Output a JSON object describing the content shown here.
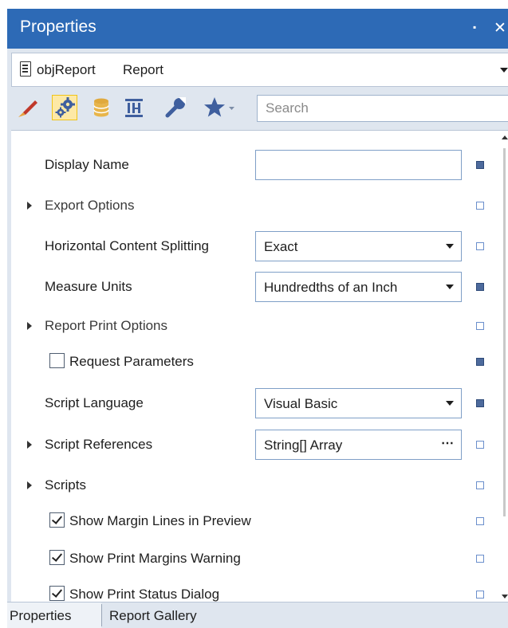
{
  "panel": {
    "title": "Properties",
    "pin_glyph": "▪",
    "close_glyph": "✕"
  },
  "object_selector": {
    "name": "objReport",
    "type": "Report"
  },
  "toolbar": {
    "icons": [
      "brush-icon",
      "gears-icon",
      "database-icon",
      "column-layout-icon",
      "wrench-icon",
      "star-icon"
    ],
    "active_icon": "gears-icon",
    "search_placeholder": "Search"
  },
  "properties": [
    {
      "label": "Display Name",
      "kind": "text",
      "value": "",
      "expandable": false,
      "marker": "set"
    },
    {
      "label": "Export Options",
      "kind": "group",
      "expandable": true,
      "marker": "default"
    },
    {
      "label": "Horizontal Content Splitting",
      "kind": "dropdown",
      "value": "Exact",
      "expandable": false,
      "marker": "default"
    },
    {
      "label": "Measure Units",
      "kind": "dropdown",
      "value": "Hundredths of an Inch",
      "expandable": false,
      "marker": "set"
    },
    {
      "label": "Report Print Options",
      "kind": "group",
      "expandable": true,
      "marker": "default"
    },
    {
      "label": "Request Parameters",
      "kind": "checkbox",
      "checked": false,
      "marker": "set"
    },
    {
      "label": "Script Language",
      "kind": "dropdown",
      "value": "Visual Basic",
      "expandable": false,
      "marker": "set"
    },
    {
      "label": "Script References",
      "kind": "ellipsis",
      "value": "String[] Array",
      "expandable": true,
      "marker": "default"
    },
    {
      "label": "Scripts",
      "kind": "group",
      "expandable": true,
      "marker": "default"
    },
    {
      "label": "Show Margin Lines in Preview",
      "kind": "checkbox",
      "checked": true,
      "marker": "default"
    },
    {
      "label": "Show Print Margins Warning",
      "kind": "checkbox",
      "checked": true,
      "marker": "default"
    },
    {
      "label": "Show Print Status Dialog",
      "kind": "checkbox",
      "checked": true,
      "marker": "default"
    }
  ],
  "ellipsis_glyph": "⋯",
  "tabs": [
    {
      "label": "Properties",
      "active": true
    },
    {
      "label": "Report Gallery",
      "active": false
    }
  ],
  "colors": {
    "title_bar": "#2d6ab6",
    "panel_bg": "#dfe6ef",
    "active_tool": "#fde9a6",
    "marker_set": "#4d6a9c"
  }
}
